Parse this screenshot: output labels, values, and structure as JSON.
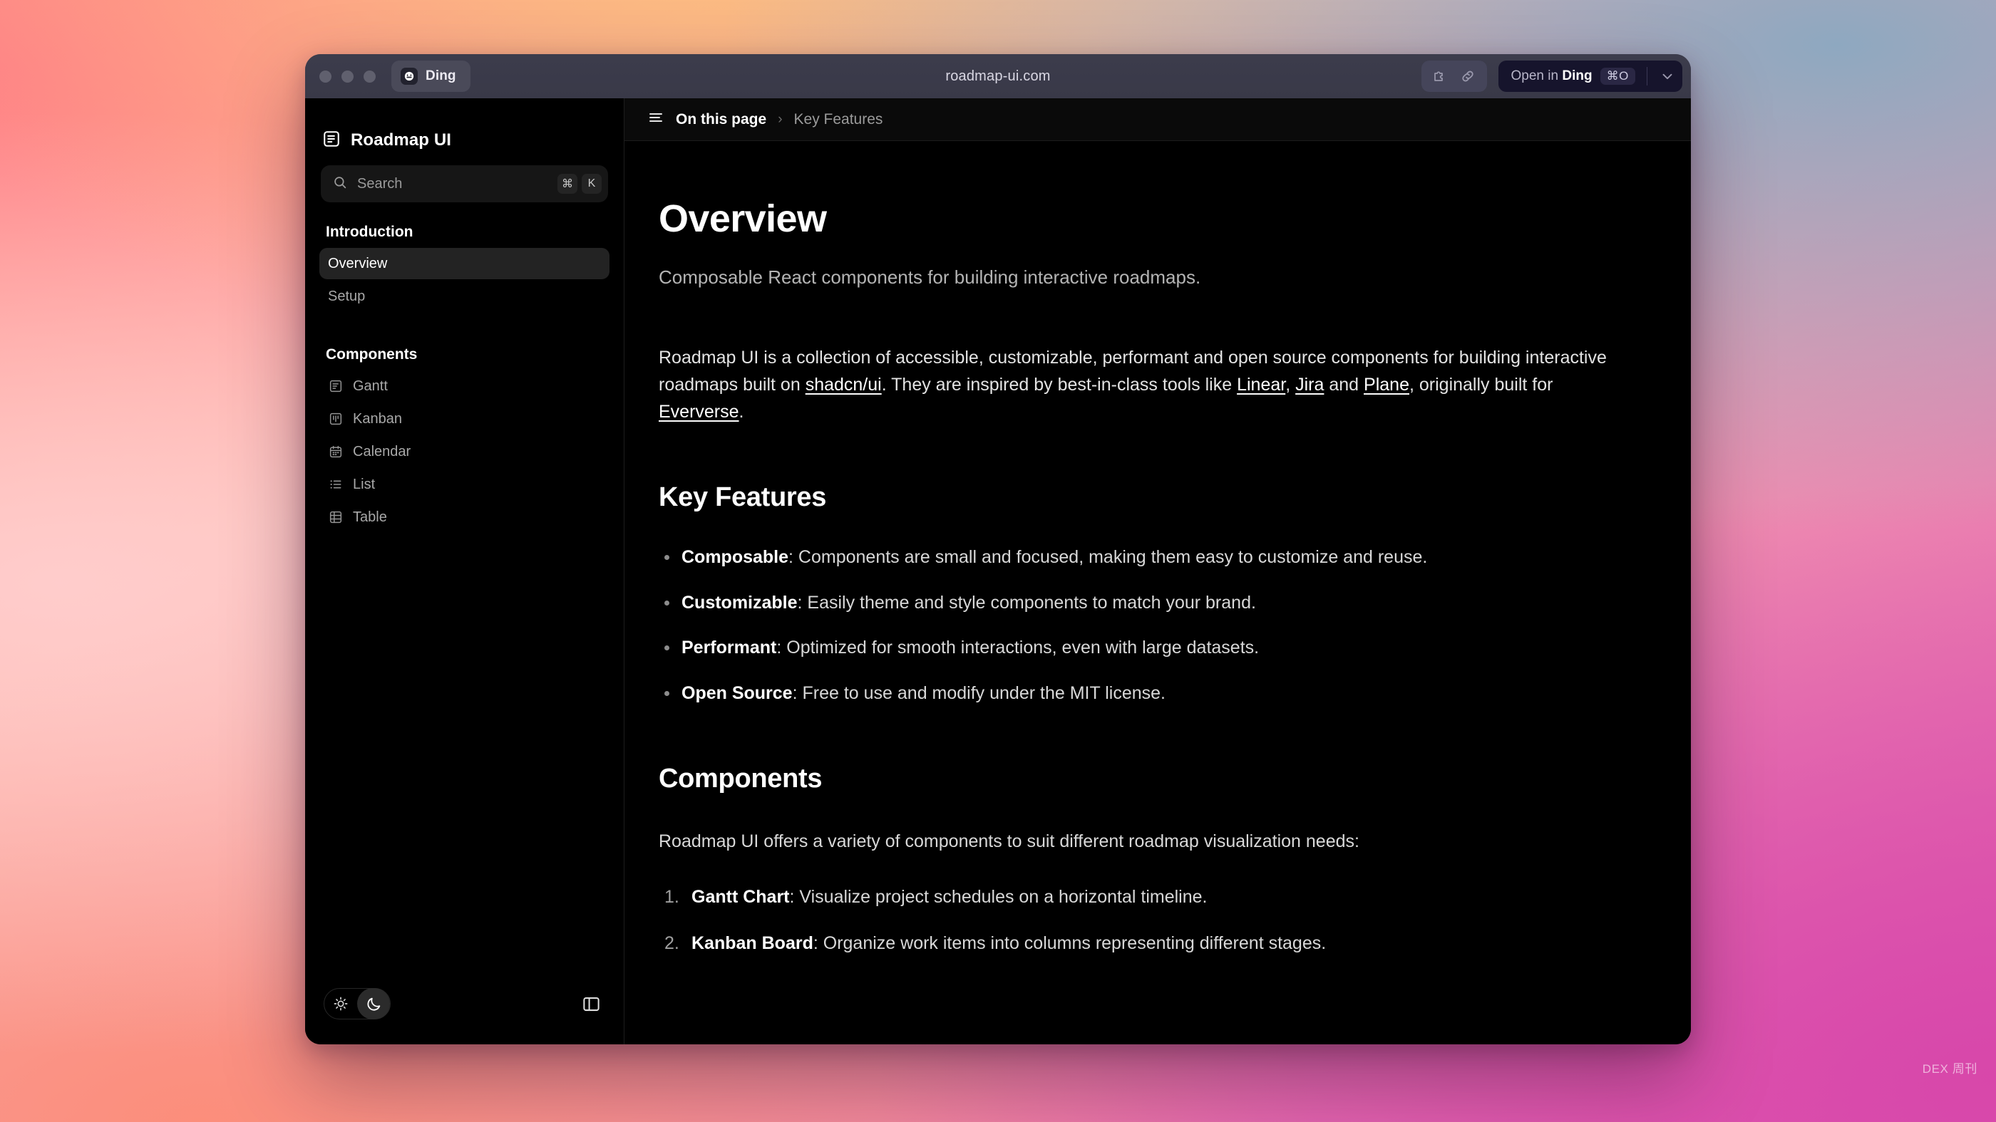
{
  "browser": {
    "tab": {
      "label": "Ding",
      "icon": "smiley-icon"
    },
    "url": "roadmap-ui.com",
    "tools": {
      "extension_icon": "puzzle-piece-icon",
      "link_icon": "link-icon"
    },
    "open_button": {
      "prefix": "Open in ",
      "app": "Ding",
      "shortcut": "⌘O",
      "caret_icon": "chevron-down-icon"
    }
  },
  "sidebar": {
    "brand": {
      "name": "Roadmap UI",
      "icon": "doc-panel-icon"
    },
    "search": {
      "placeholder": "Search",
      "icon": "search-icon",
      "keys": [
        "⌘",
        "K"
      ]
    },
    "groups": [
      {
        "title": "Introduction",
        "items": [
          {
            "label": "Overview",
            "active": true
          },
          {
            "label": "Setup",
            "active": false
          }
        ]
      },
      {
        "title": "Components",
        "items": [
          {
            "label": "Gantt",
            "icon": "gantt-icon",
            "active": false
          },
          {
            "label": "Kanban",
            "icon": "kanban-icon",
            "active": false
          },
          {
            "label": "Calendar",
            "icon": "calendar-icon",
            "active": false
          },
          {
            "label": "List",
            "icon": "list-icon",
            "active": false
          },
          {
            "label": "Table",
            "icon": "table-icon",
            "active": false
          }
        ]
      }
    ],
    "footer": {
      "theme": {
        "light_icon": "sun-icon",
        "dark_icon": "moon-icon",
        "selected": "dark"
      },
      "panel_toggle_icon": "sidebar-panel-icon"
    }
  },
  "breadcrumb": {
    "menu_icon": "hamburger-menu-icon",
    "root": "On this page",
    "separator": "›",
    "current": "Key Features"
  },
  "article": {
    "title": "Overview",
    "lead": "Composable React components for building interactive roadmaps.",
    "intro": {
      "part1": "Roadmap UI is a collection of accessible, customizable, performant and open source components for building interactive roadmaps built on ",
      "link1": "shadcn/ui",
      "part2": ". They are inspired by best-in-class tools like ",
      "link2": "Linear",
      "part3": ", ",
      "link3": "Jira",
      "part4": " and ",
      "link4": "Plane",
      "part5": ", originally built for ",
      "link5": "Eververse",
      "part6": "."
    },
    "key_features": {
      "heading": "Key Features",
      "items": [
        {
          "term": "Composable",
          "desc": ": Components are small and focused, making them easy to customize and reuse."
        },
        {
          "term": "Customizable",
          "desc": ": Easily theme and style components to match your brand."
        },
        {
          "term": "Performant",
          "desc": ": Optimized for smooth interactions, even with large datasets."
        },
        {
          "term": "Open Source",
          "desc": ": Free to use and modify under the MIT license."
        }
      ]
    },
    "components": {
      "heading": "Components",
      "intro": "Roadmap UI offers a variety of components to suit different roadmap visualization needs:",
      "items": [
        {
          "term": "Gantt Chart",
          "desc": ": Visualize project schedules on a horizontal timeline."
        },
        {
          "term": "Kanban Board",
          "desc": ": Organize work items into columns representing different stages."
        }
      ]
    }
  },
  "watermark": "DEX 周刊",
  "colors": {
    "page_background": "#000000",
    "sidebar_active": "#232323",
    "titlebar": "#393948",
    "open_button": "#16142c",
    "accent_text": "#ffffff"
  }
}
